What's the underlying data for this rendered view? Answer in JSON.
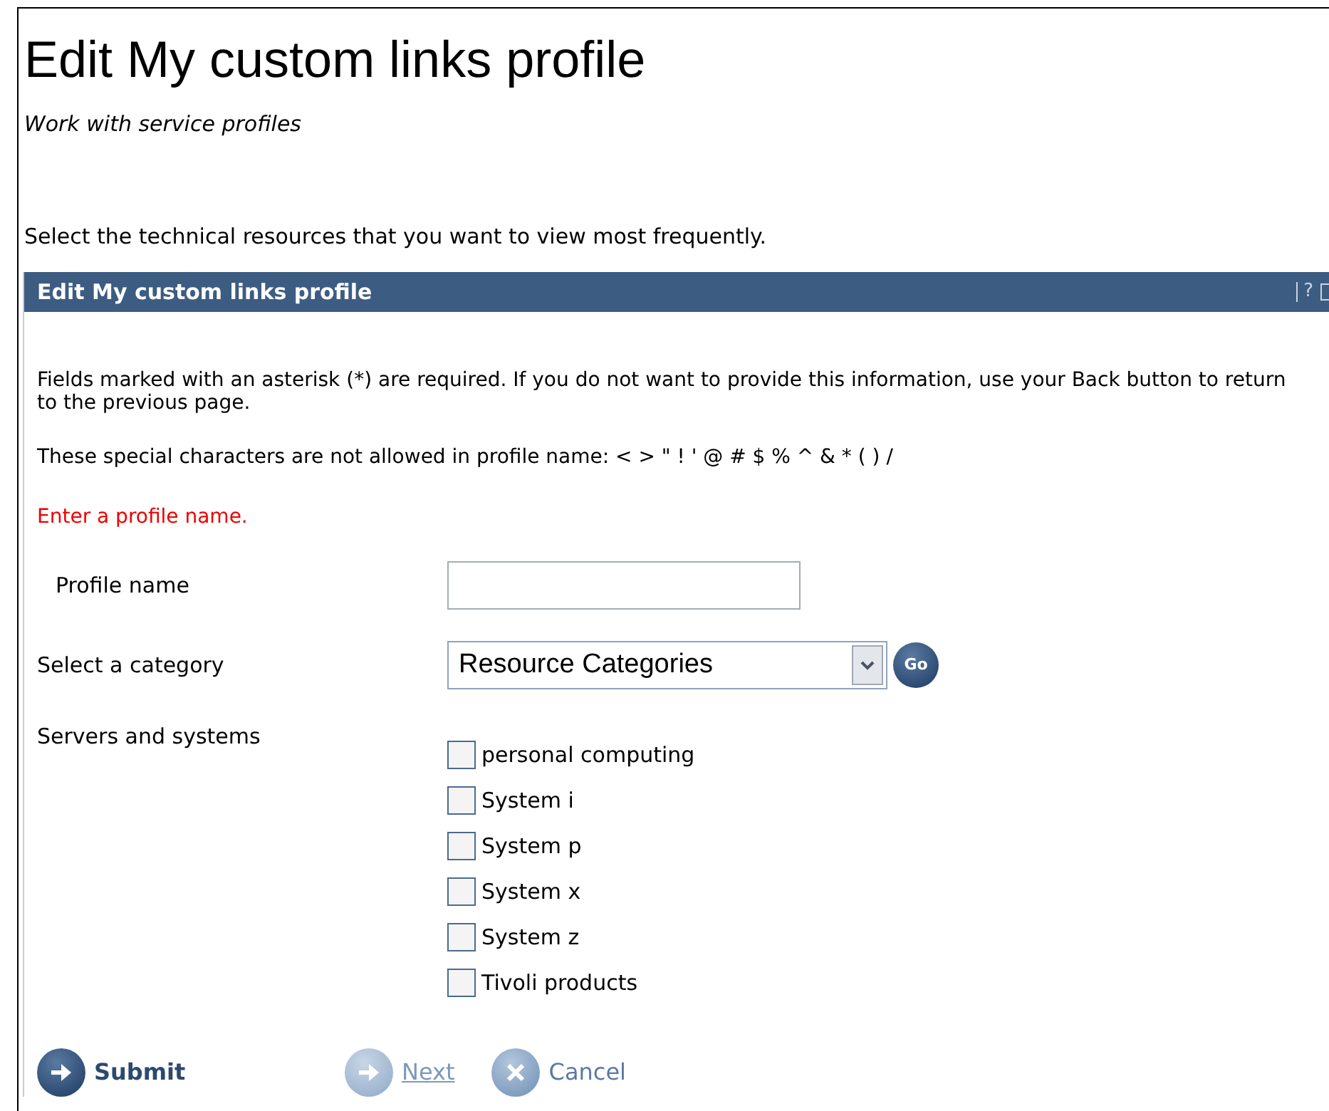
{
  "title": "Edit My custom links profile",
  "subtitle": "Work with service profiles",
  "intro": "Select the technical resources that you want to view most frequently.",
  "panel": {
    "title": "Edit My custom links profile",
    "header_icons": [
      "?"
    ],
    "notes": [
      "Fields marked with an asterisk (*) are required. If you do not want to provide this information, use your Back button to return to the previous page.",
      "These special characters are not allowed in profile name: < > \" ! ' @ # $ % ^ & * ( ) /"
    ],
    "error": "Enter a profile name.",
    "profile_name": {
      "label": "Profile name"
    },
    "category": {
      "label": "Select a category",
      "value": "Resource Categories",
      "go": "Go"
    },
    "systems": {
      "label": "Servers and systems",
      "options": [
        {
          "label": "personal computing",
          "checked": false
        },
        {
          "label": "System i",
          "checked": false
        },
        {
          "label": "System p",
          "checked": false
        },
        {
          "label": "System x",
          "checked": false
        },
        {
          "label": "System z",
          "checked": false
        },
        {
          "label": "Tivoli products",
          "checked": false
        }
      ]
    },
    "buttons": [
      {
        "label": "Submit",
        "kind": "arrow",
        "disabled": false
      },
      {
        "label": "Next",
        "kind": "arrow",
        "disabled": true
      },
      {
        "label": "Cancel",
        "kind": "close",
        "disabled": false
      }
    ]
  }
}
